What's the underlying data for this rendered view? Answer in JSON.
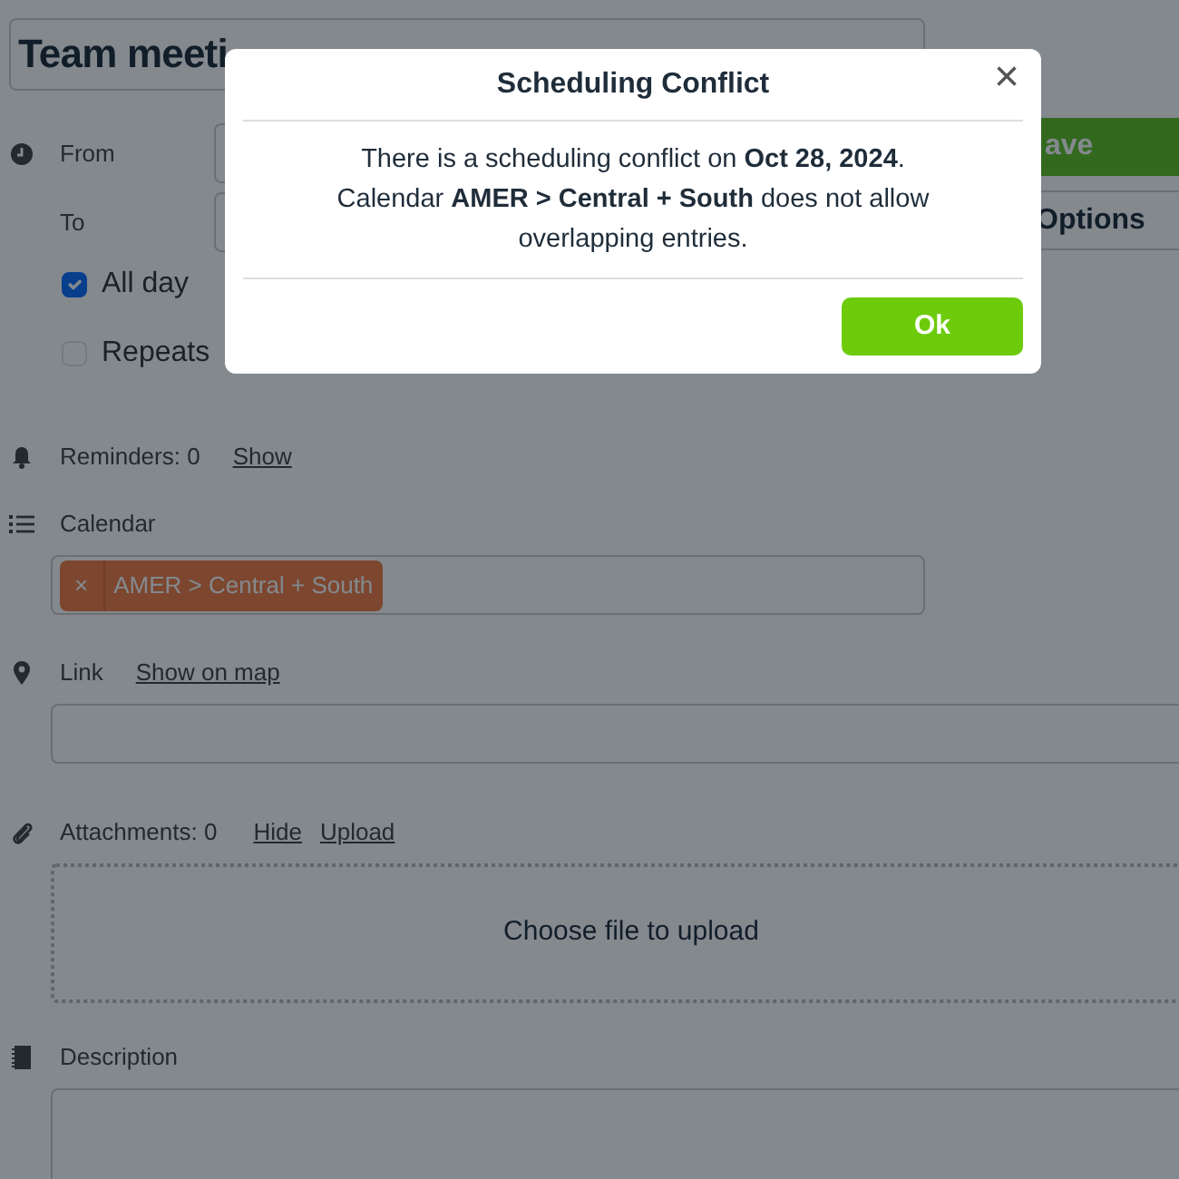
{
  "event": {
    "title": "Team meeti",
    "from_label": "From",
    "to_label": "To",
    "all_day": {
      "label": "All day",
      "checked": true
    },
    "repeats": {
      "label": "Repeats",
      "checked": false
    }
  },
  "save_button": "ave",
  "options_button": "Options",
  "reminders": {
    "label": "Reminders: 0",
    "link": "Show"
  },
  "calendar": {
    "label": "Calendar",
    "tags": [
      {
        "remove": "×",
        "text": "AMER > Central + South"
      }
    ]
  },
  "link": {
    "label": "Link",
    "action": "Show on map"
  },
  "attachments": {
    "label": "Attachments: 0",
    "links": [
      "Hide",
      "Upload"
    ],
    "dropzone": "Choose file to upload"
  },
  "description": {
    "label": "Description"
  },
  "dialog": {
    "title": "Scheduling Conflict",
    "close": "×",
    "message": "There is a scheduling conflict on **Oct 28, 2024**. Calendar **AMER > Central + South** does not allow overlapping entries.",
    "button": "Ok"
  }
}
